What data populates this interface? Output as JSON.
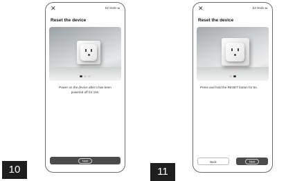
{
  "steps": [
    {
      "number": "10",
      "close_icon": "close-icon",
      "mode_label": "EZ Mode",
      "title": "Reset the device",
      "instruction": "Power on the device after it has been powered off for 10s.",
      "carousel_dots": {
        "count": 3,
        "active_index": 0
      },
      "next_label": "Next"
    },
    {
      "number": "11",
      "close_icon": "close-icon",
      "mode_label": "EZ Mode",
      "title": "Reset the device",
      "instruction": "Press and hold the RESET button for 5s.",
      "carousel_dots": {
        "count": 2,
        "active_index": 1
      },
      "back_label": "Back",
      "next_label": "Next"
    }
  ]
}
